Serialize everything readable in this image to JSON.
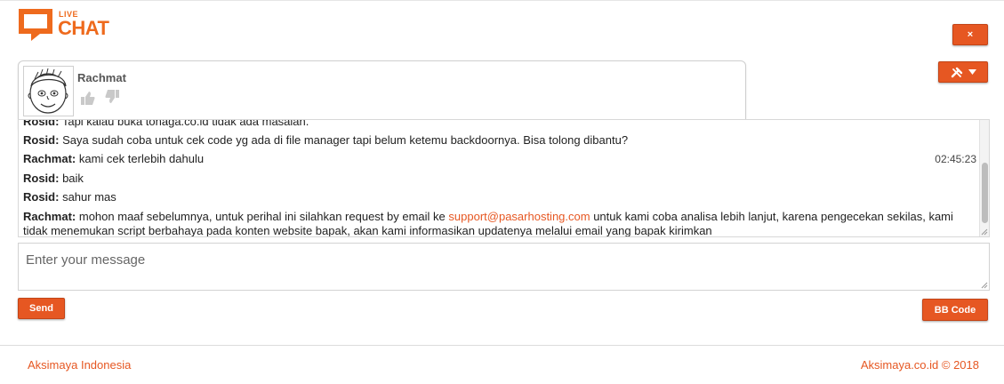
{
  "brand": {
    "logo_small": "LIVE",
    "logo_large": "CHAT",
    "accent_color": "#e65722"
  },
  "header": {
    "close_label": "×",
    "tools_icon": "tools-icon",
    "dropdown_icon": "caret-down-icon"
  },
  "operator": {
    "name": "Rachmat",
    "avatar_icon": "user-avatar-icon",
    "rate_up_icon": "thumb-up-icon",
    "rate_down_icon": "thumb-down-icon"
  },
  "messages": [
    {
      "sender": "Rosid:",
      "text": "Tapi kalau buka tonaga.co.id tidak ada masalah."
    },
    {
      "sender": "Rosid:",
      "text": "Saya sudah coba untuk cek code yg ada di file manager tapi belum ketemu backdoornya. Bisa tolong dibantu?"
    },
    {
      "sender": "Rachmat:",
      "text": "kami cek terlebih dahulu",
      "time": "02:45:23"
    },
    {
      "sender": "Rosid:",
      "text": "baik"
    },
    {
      "sender": "Rosid:",
      "text": "sahur mas"
    },
    {
      "sender": "Rachmat:",
      "text_before": "mohon maaf sebelumnya, untuk perihal ini silahkan request by email ke",
      "link": "support@pasarhosting.com",
      "text_after": "untuk kami coba analisa lebih lanjut, karena pengecekan sekilas, kami tidak menemukan script berbahaya pada konten website bapak, akan kami informasikan updatenya melalui email yang bapak kirimkan"
    }
  ],
  "composer": {
    "placeholder": "Enter your message",
    "value": "",
    "send_label": "Send",
    "bbcode_label": "BB Code"
  },
  "footer": {
    "left_text": "Aksimaya Indonesia",
    "right_text": "Aksimaya.co.id © 2018"
  }
}
